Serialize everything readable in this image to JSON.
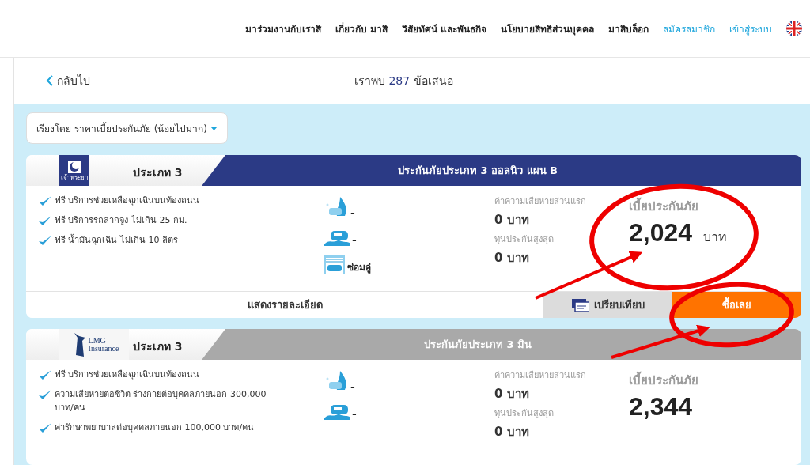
{
  "nav": {
    "links": [
      {
        "label": "มาร่วมงานกับเราสิ",
        "kind": "page"
      },
      {
        "label": "เกี่ยวกับ มาสิ",
        "kind": "page"
      },
      {
        "label": "วิสัยทัศน์ และพันธกิจ",
        "kind": "page"
      },
      {
        "label": "นโยบายสิทธิส่วนบุคคล",
        "kind": "page"
      },
      {
        "label": "มาสิบล็อก",
        "kind": "page"
      },
      {
        "label": "สมัครสมาชิก",
        "kind": "account"
      },
      {
        "label": "เข้าสู่ระบบ",
        "kind": "account"
      }
    ]
  },
  "results": {
    "back": "กลับไป",
    "prefix": "เราพบ",
    "count": "287",
    "suffix": "ข้อเสนอ"
  },
  "sort": {
    "label": "เรียงโดย ราคาเบี้ยประกันภัย (น้อยไปมาก)"
  },
  "offers": [
    {
      "logo": {
        "kind": "crescent",
        "lines": [
          "เจ้าพระยา"
        ]
      },
      "type": "ประเภท 3",
      "title": "ประกันภัยประเภท 3 ออลนิว แผน B",
      "highlighted": true,
      "features": [
        "ฟรี บริการช่วยเหลือฉุกเฉินบนท้องถนน",
        "ฟรี บริการรถลากจูง ไม่เกิน 25 กม.",
        "ฟรี น้ำมันฉุกเฉิน ไม่เกิน 10 ลิตร"
      ],
      "coverage": [
        {
          "kind": "fire",
          "text": "-"
        },
        {
          "kind": "flood",
          "text": "-"
        },
        {
          "kind": "garage",
          "text": "ซ่อมอู่"
        }
      ],
      "deductible_label": "ค่าความเสียหายส่วนแรก",
      "deductible": "0 บาท",
      "max_label": "ทุนประกันสูงสุด",
      "max": "0 บาท",
      "premium_label": "เบี้ยประกันภัย",
      "premium": "2,024",
      "currency": "บาท",
      "actions": {
        "details": "แสดงรายละเอียด",
        "compare": "เปรียบเทียบ",
        "buy": "ซื้อเลย"
      }
    },
    {
      "logo": {
        "kind": "statue",
        "lines": [
          "LMG",
          "Insurance"
        ]
      },
      "type": "ประเภท 3",
      "title": "ประกันภัยประเภท 3 มิน",
      "highlighted": false,
      "features": [
        "ฟรี บริการช่วยเหลือฉุกเฉินบนท้องถนน",
        "ความเสียหายต่อชีวิต ร่างกายต่อบุคคลภายนอก 300,000 บาท/คน",
        "ค่ารักษาพยาบาลต่อบุคคลภายนอก 100,000 บาท/คน"
      ],
      "coverage": [
        {
          "kind": "fire",
          "text": "-"
        },
        {
          "kind": "flood",
          "text": "-"
        }
      ],
      "deductible_label": "ค่าความเสียหายส่วนแรก",
      "deductible": "0 บาท",
      "max_label": "ทุนประกันสูงสุด",
      "max": "0 บาท",
      "premium_label": "เบี้ยประกันภัย",
      "premium": "2,344"
    }
  ],
  "annotations": [
    {
      "kind": "ellipse"
    },
    {
      "kind": "arrow"
    },
    {
      "kind": "ellipse"
    },
    {
      "kind": "arrow"
    }
  ]
}
